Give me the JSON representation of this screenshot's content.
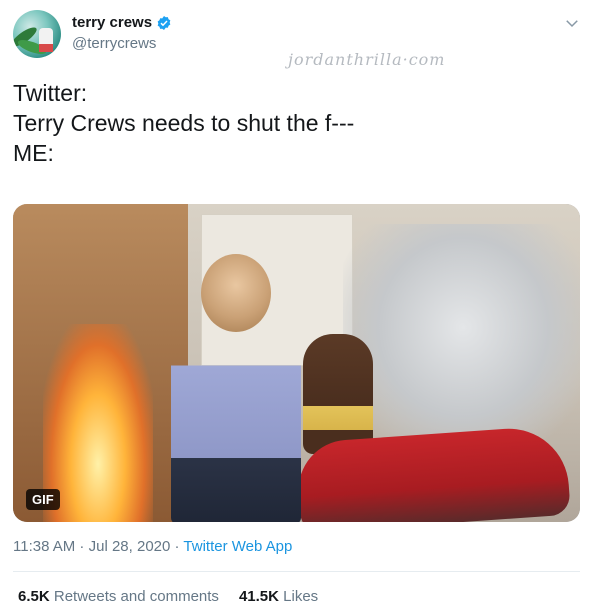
{
  "user": {
    "display_name": "terry crews",
    "handle": "@terrycrews",
    "verified": true,
    "avatar_icon": "avatar-photo"
  },
  "header": {
    "menu_icon": "chevron-down-icon"
  },
  "watermark": "jordanthrilla·com",
  "tweet": {
    "lines": [
      "Twitter:",
      "Terry Crews needs to shut the f---",
      "",
      "ME:"
    ]
  },
  "media": {
    "badge": "GIF"
  },
  "meta": {
    "time": "11:38 AM",
    "separator1": " · ",
    "date": "Jul 28, 2020",
    "separator2": " · ",
    "app": "Twitter Web App"
  },
  "stats": {
    "retweets_count": "6.5K",
    "retweets_label": "Retweets and comments",
    "likes_count": "41.5K",
    "likes_label": "Likes"
  },
  "colors": {
    "link": "#1b95e0",
    "secondary_text": "#657786",
    "primary_text": "#14171a",
    "verified_badge": "#1da1f2"
  }
}
